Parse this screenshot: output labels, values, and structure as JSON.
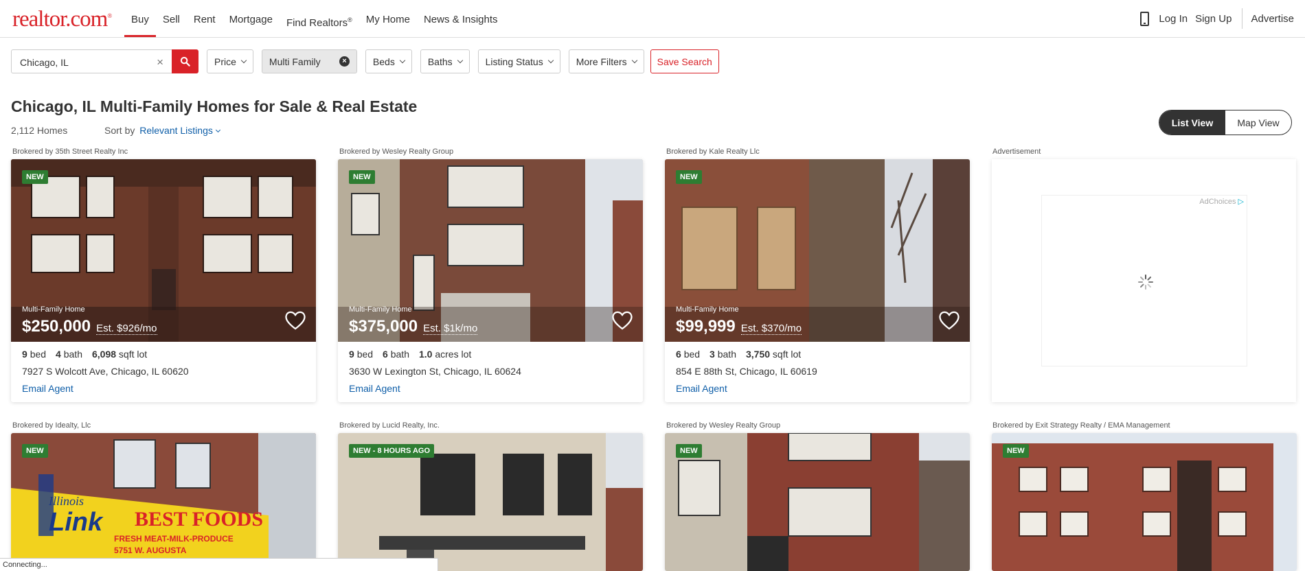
{
  "header": {
    "logo": "realtor.com",
    "logo_mark": "®",
    "nav": [
      "Buy",
      "Sell",
      "Rent",
      "Mortgage",
      "Find Realtors",
      "My Home",
      "News & Insights"
    ],
    "nav_sup": "®",
    "login": "Log In",
    "signup": "Sign Up",
    "advertise": "Advertise"
  },
  "filters": {
    "location": "Chicago, IL",
    "price": "Price",
    "property_type": "Multi Family",
    "beds": "Beds",
    "baths": "Baths",
    "listing_status": "Listing Status",
    "more_filters": "More Filters",
    "save_search": "Save Search"
  },
  "results": {
    "title": "Chicago, IL Multi-Family Homes for Sale & Real Estate",
    "count": "2,112 Homes",
    "sort_label": "Sort by",
    "sort_value": "Relevant Listings",
    "list_view": "List View",
    "map_view": "Map View"
  },
  "listings": [
    {
      "broker": "Brokered by 35th Street Realty Inc",
      "badge": "NEW",
      "type": "Multi-Family Home",
      "price": "$250,000",
      "est": "Est. $926/mo",
      "beds": "9",
      "baths": "4",
      "lot": "6,098",
      "lot_unit": "sqft lot",
      "address": "7927 S Wolcott Ave, Chicago, IL 60620",
      "email": "Email Agent"
    },
    {
      "broker": "Brokered by Wesley Realty Group",
      "badge": "NEW",
      "type": "Multi-Family Home",
      "price": "$375,000",
      "est": "Est. $1k/mo",
      "beds": "9",
      "baths": "6",
      "lot": "1.0",
      "lot_unit": "acres lot",
      "address": "3630 W Lexington St, Chicago, IL 60624",
      "email": "Email Agent"
    },
    {
      "broker": "Brokered by Kale Realty Llc",
      "badge": "NEW",
      "type": "Multi-Family Home",
      "price": "$99,999",
      "est": "Est. $370/mo",
      "beds": "6",
      "baths": "3",
      "lot": "3,750",
      "lot_unit": "sqft lot",
      "address": "854 E 88th St, Chicago, IL 60619",
      "email": "Email Agent"
    }
  ],
  "labels": {
    "bed": "bed",
    "bath": "bath"
  },
  "ad": {
    "label": "Advertisement",
    "adchoices": "AdChoices"
  },
  "row2": [
    {
      "broker": "Brokered by Idealty, Llc",
      "badge": "NEW"
    },
    {
      "broker": "Brokered by Lucid Realty, Inc.",
      "badge": "NEW - 8 HOURS AGO"
    },
    {
      "broker": "Brokered by Wesley Realty Group",
      "badge": "NEW"
    },
    {
      "broker": "Brokered by Exit Strategy Realty / EMA Management",
      "badge": "NEW"
    }
  ],
  "row2_sign": {
    "state": "Illinois",
    "name": "Link",
    "store": "BEST FOODS",
    "sub": "FRESH MEAT-MILK-PRODUCE",
    "address": "5751 W. AUGUSTA"
  },
  "status_bar": "Connecting..."
}
